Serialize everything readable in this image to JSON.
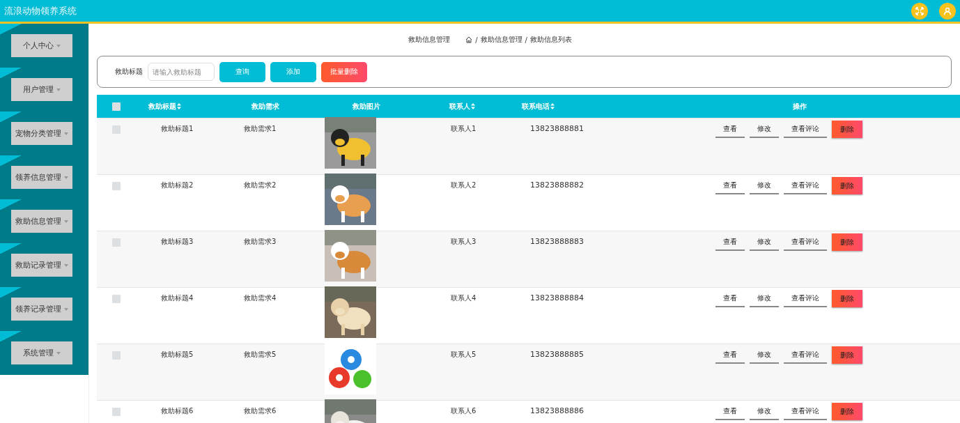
{
  "header": {
    "title": "流浪动物领养系统"
  },
  "sidebar": {
    "items": [
      {
        "label": "个人中心"
      },
      {
        "label": "用户管理"
      },
      {
        "label": "宠物分类管理"
      },
      {
        "label": "领养信息管理"
      },
      {
        "label": "救助信息管理"
      },
      {
        "label": "救助记录管理"
      },
      {
        "label": "领养记录管理"
      },
      {
        "label": "系统管理"
      }
    ]
  },
  "breadcrumb": {
    "title": "救助信息管理",
    "path": [
      {
        "separator": "/",
        "label": "救助信息管理"
      },
      {
        "separator": "/",
        "label": "救助信息列表"
      }
    ]
  },
  "search": {
    "label": "救助标题",
    "placeholder": "请输入救助标题",
    "buttons": [
      {
        "label": "查询",
        "kind": "primary"
      },
      {
        "label": "添加",
        "kind": "primary"
      },
      {
        "label": "批量删除",
        "kind": "danger"
      }
    ]
  },
  "table": {
    "select_all": {
      "checked": false
    },
    "columns": [
      {
        "label": "救助标题",
        "sortable": true
      },
      {
        "label": "救助需求",
        "sortable": false
      },
      {
        "label": "救助图片",
        "sortable": false
      },
      {
        "label": "联系人",
        "sortable": true
      },
      {
        "label": "联系电话",
        "sortable": true
      },
      {
        "label": "操作",
        "sortable": false
      }
    ],
    "rows": [
      {
        "checked": false,
        "title": "救助标题1",
        "need": "救助需求1",
        "contact": "联系人1",
        "phone": "13823888881",
        "actions": [
          {
            "label": "查看",
            "kind": "link"
          },
          {
            "label": "修改",
            "kind": "link"
          },
          {
            "label": "查看评论",
            "kind": "link"
          },
          {
            "label": "删除",
            "kind": "danger"
          }
        ]
      },
      {
        "checked": false,
        "title": "救助标题2",
        "need": "救助需求2",
        "contact": "联系人2",
        "phone": "13823888882",
        "actions": [
          {
            "label": "查看",
            "kind": "link"
          },
          {
            "label": "修改",
            "kind": "link"
          },
          {
            "label": "查看评论",
            "kind": "link"
          },
          {
            "label": "删除",
            "kind": "danger"
          }
        ]
      },
      {
        "checked": false,
        "title": "救助标题3",
        "need": "救助需求3",
        "contact": "联系人3",
        "phone": "13823888883",
        "actions": [
          {
            "label": "查看",
            "kind": "link"
          },
          {
            "label": "修改",
            "kind": "link"
          },
          {
            "label": "查看评论",
            "kind": "link"
          },
          {
            "label": "删除",
            "kind": "danger"
          }
        ]
      },
      {
        "checked": false,
        "title": "救助标题4",
        "need": "救助需求4",
        "contact": "联系人4",
        "phone": "13823888884",
        "actions": [
          {
            "label": "查看",
            "kind": "link"
          },
          {
            "label": "修改",
            "kind": "link"
          },
          {
            "label": "查看评论",
            "kind": "link"
          },
          {
            "label": "删除",
            "kind": "danger"
          }
        ]
      },
      {
        "checked": false,
        "title": "救助标题5",
        "need": "救助需求5",
        "contact": "联系人5",
        "phone": "13823888885",
        "actions": [
          {
            "label": "查看",
            "kind": "link"
          },
          {
            "label": "修改",
            "kind": "link"
          },
          {
            "label": "查看评论",
            "kind": "link"
          },
          {
            "label": "删除",
            "kind": "danger"
          }
        ]
      },
      {
        "checked": false,
        "title": "救助标题6",
        "need": "救助需求6",
        "contact": "联系人6",
        "phone": "13823888886",
        "actions": [
          {
            "label": "查看",
            "kind": "link"
          },
          {
            "label": "修改",
            "kind": "link"
          },
          {
            "label": "查看评论",
            "kind": "link"
          },
          {
            "label": "删除",
            "kind": "danger"
          }
        ]
      }
    ]
  }
}
